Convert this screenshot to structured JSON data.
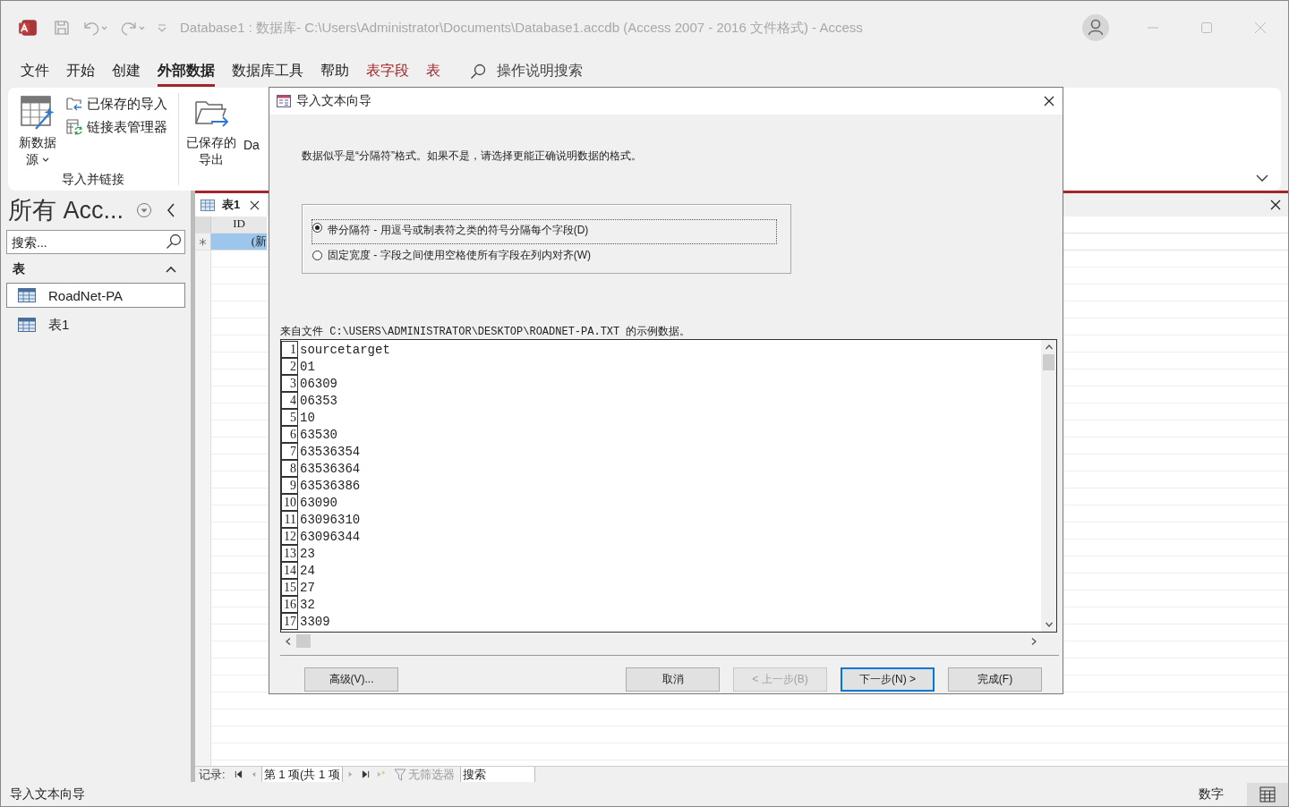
{
  "titlebar": {
    "title": "Database1 : 数据库- C:\\Users\\Administrator\\Documents\\Database1.accdb (Access 2007 - 2016 文件格式)  -  Access"
  },
  "menu": [
    {
      "label": "文件",
      "selected": false,
      "kind": "normal"
    },
    {
      "label": "开始",
      "selected": false,
      "kind": "normal"
    },
    {
      "label": "创建",
      "selected": false,
      "kind": "normal"
    },
    {
      "label": "外部数据",
      "selected": true,
      "kind": "normal"
    },
    {
      "label": "数据库工具",
      "selected": false,
      "kind": "normal"
    },
    {
      "label": "帮助",
      "selected": false,
      "kind": "normal"
    },
    {
      "label": "表字段",
      "selected": false,
      "kind": "context"
    },
    {
      "label": "表",
      "selected": false,
      "kind": "context"
    }
  ],
  "tell_me": "操作说明搜索",
  "ribbon": {
    "new_source": "新数据",
    "new_source_2": "源",
    "saved_imports": "已保存的导入",
    "linked_table_manager": "链接表管理器",
    "group_label": "导入并链接",
    "saved_exports": "已保存的",
    "saved_exports_2": "导出",
    "cut_label": "Da"
  },
  "nav_pane": {
    "title": "所有 Acc...",
    "search_placeholder": "搜索...",
    "section": "表",
    "items": [
      {
        "label": "RoadNet-PA",
        "selected": true
      },
      {
        "label": "表1",
        "selected": false
      }
    ]
  },
  "document_tab": {
    "label": "表1"
  },
  "datasheet": {
    "column": "ID",
    "new_row": "(新"
  },
  "record_nav": {
    "label": "记录:",
    "position": "第 1 项(共 1 项",
    "filter": "无筛选器",
    "search": "搜索"
  },
  "status_bar": {
    "text": "导入文本向导",
    "mode": "数字"
  },
  "dialog": {
    "title": "导入文本向导",
    "prompt": "数据似乎是“分隔符”格式。如果不是，请选择更能正确说明数据的格式。",
    "options": [
      {
        "label": "带分隔符 - 用逗号或制表符之类的符号分隔每个字段(D)",
        "selected": true
      },
      {
        "label": "固定宽度 - 字段之间使用空格使所有字段在列内对齐(W)",
        "selected": false
      }
    ],
    "sample_caption": "来自文件 C:\\USERS\\ADMINISTRATOR\\DESKTOP\\ROADNET-PA.TXT 的示例数据。",
    "sample_lines": [
      {
        "n": "1",
        "text": "sourcetarget"
      },
      {
        "n": "2",
        "text": "01"
      },
      {
        "n": "3",
        "text": "06309"
      },
      {
        "n": "4",
        "text": "06353"
      },
      {
        "n": "5",
        "text": "10"
      },
      {
        "n": "6",
        "text": "63530"
      },
      {
        "n": "7",
        "text": "63536354"
      },
      {
        "n": "8",
        "text": "63536364"
      },
      {
        "n": "9",
        "text": "63536386"
      },
      {
        "n": "10",
        "text": "63090"
      },
      {
        "n": "11",
        "text": "63096310"
      },
      {
        "n": "12",
        "text": "63096344"
      },
      {
        "n": "13",
        "text": "23"
      },
      {
        "n": "14",
        "text": "24"
      },
      {
        "n": "15",
        "text": "27"
      },
      {
        "n": "16",
        "text": "32"
      },
      {
        "n": "17",
        "text": "3309"
      }
    ],
    "buttons": [
      {
        "label": "高级(V)...",
        "disabled": false,
        "default": false
      },
      {
        "label": "取消",
        "disabled": false,
        "default": false
      },
      {
        "label": "< 上一步(B)",
        "disabled": true,
        "default": false
      },
      {
        "label": "下一步(N) >",
        "disabled": false,
        "default": true
      },
      {
        "label": "完成(F)",
        "disabled": false,
        "default": false
      }
    ]
  }
}
